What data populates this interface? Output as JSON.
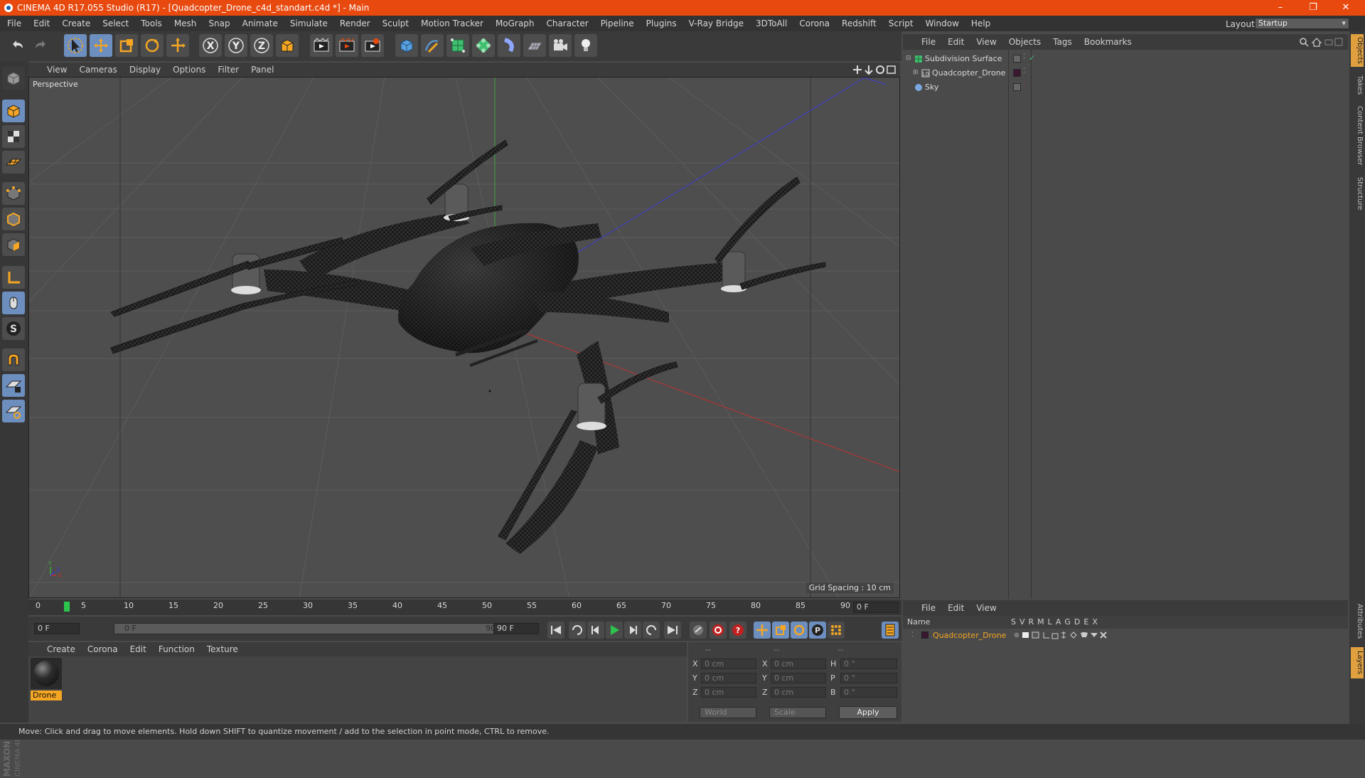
{
  "window": {
    "title": "CINEMA 4D R17.055 Studio (R17) - [Quadcopter_Drone_c4d_standart.c4d *] - Main",
    "controls": [
      "–",
      "❐",
      "✕"
    ]
  },
  "menubar": {
    "items": [
      "File",
      "Edit",
      "Create",
      "Select",
      "Tools",
      "Mesh",
      "Snap",
      "Animate",
      "Simulate",
      "Render",
      "Sculpt",
      "Motion Tracker",
      "MoGraph",
      "Character",
      "Pipeline",
      "Plugins",
      "V-Ray Bridge",
      "3DToAll",
      "Corona",
      "Redshift",
      "Script",
      "Window",
      "Help"
    ],
    "layout_label": "Layout:",
    "layout_value": "Startup"
  },
  "viewport": {
    "menu": [
      "View",
      "Cameras",
      "Display",
      "Options",
      "Filter",
      "Panel"
    ],
    "camera_label": "Perspective",
    "grid_spacing": "Grid Spacing : 10 cm",
    "background_color": "#4e4e4e",
    "model_name": "Quadcopter_Drone"
  },
  "timeline": {
    "ticks": [
      "0",
      "5",
      "10",
      "15",
      "20",
      "25",
      "30",
      "35",
      "40",
      "45",
      "50",
      "55",
      "60",
      "65",
      "70",
      "75",
      "80",
      "85",
      "90"
    ],
    "current_frame": "0 F",
    "start_frame": "0 F",
    "range_start": "0 F",
    "range_end": "90 F",
    "end_frame": "90 F",
    "playhead_color": "#2cc44c"
  },
  "material_manager": {
    "menu": [
      "Create",
      "Corona",
      "Edit",
      "Function",
      "Texture"
    ],
    "materials": [
      {
        "name": "Drone"
      }
    ]
  },
  "coordinates": {
    "header": [
      "--",
      "--",
      "--"
    ],
    "rows": [
      {
        "a_label": "X",
        "a_value": "0 cm",
        "b_label": "X",
        "b_value": "0 cm",
        "c_label": "H",
        "c_value": "0 °"
      },
      {
        "a_label": "Y",
        "a_value": "0 cm",
        "b_label": "Y",
        "b_value": "0 cm",
        "c_label": "P",
        "c_value": "0 °"
      },
      {
        "a_label": "Z",
        "a_value": "0 cm",
        "b_label": "Z",
        "b_value": "0 cm",
        "c_label": "B",
        "c_value": "0 °"
      }
    ],
    "mode": "World",
    "transform": "Scale",
    "apply_label": "Apply"
  },
  "object_manager": {
    "menu": [
      "File",
      "Edit",
      "View",
      "Objects",
      "Tags",
      "Bookmarks"
    ],
    "objects": [
      {
        "name": "Subdivision Surface"
      },
      {
        "name": "Quadcopter_Drone"
      },
      {
        "name": "Sky"
      }
    ]
  },
  "layer_manager": {
    "menu": [
      "File",
      "Edit",
      "View"
    ],
    "columns": {
      "name": "Name",
      "flags": [
        "S",
        "V",
        "R",
        "M",
        "L",
        "A",
        "G",
        "D",
        "E",
        "X"
      ]
    },
    "layers": [
      {
        "name": "Quadcopter_Drone",
        "color": "#3a1830"
      }
    ]
  },
  "side_tabs": [
    "Objects",
    "Takes",
    "Content Browser",
    "Structure",
    "Attributes",
    "Layers"
  ],
  "status": "Move: Click and drag to move elements. Hold down SHIFT to quantize movement / add to the selection in point mode, CTRL to remove.",
  "accent_colors": {
    "title_bar": "#e8490f",
    "selection": "#f5a623",
    "active_tool": "#6d8fbf"
  }
}
